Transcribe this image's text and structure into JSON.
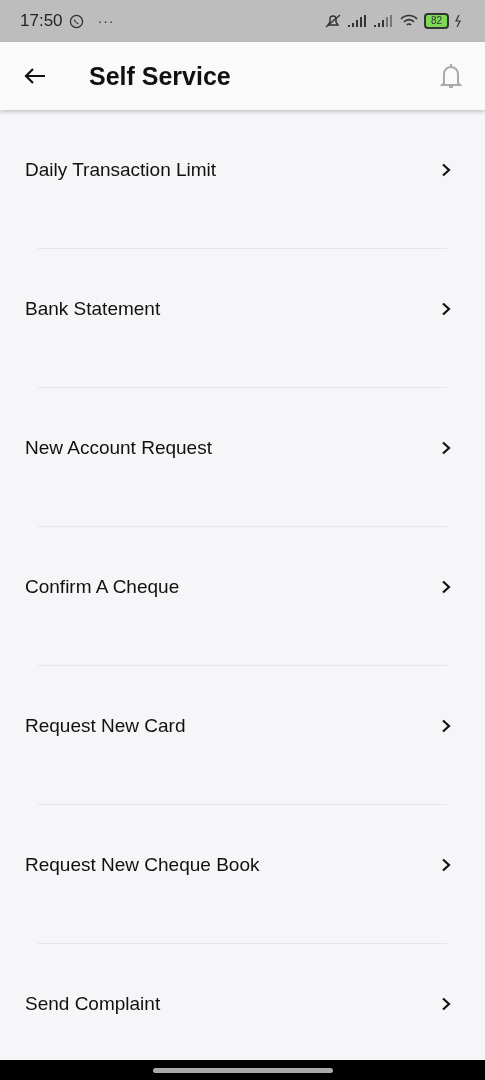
{
  "status_bar": {
    "time": "17:50",
    "more": "···",
    "battery": "82"
  },
  "header": {
    "title": "Self Service"
  },
  "items": [
    {
      "label": "Daily Transaction Limit"
    },
    {
      "label": "Bank Statement"
    },
    {
      "label": "New Account Request"
    },
    {
      "label": "Confirm A Cheque"
    },
    {
      "label": "Request New Card"
    },
    {
      "label": "Request New Cheque Book"
    },
    {
      "label": "Send Complaint"
    }
  ]
}
